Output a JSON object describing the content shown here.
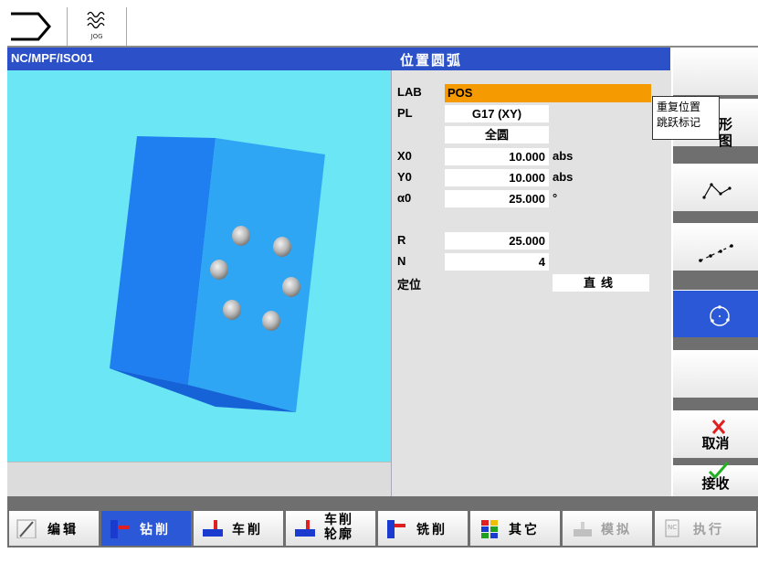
{
  "topbar": {
    "mode_label": "JOG"
  },
  "titlebar": {
    "path": "NC/MPF/ISO01",
    "title": "位置圆弧"
  },
  "params": {
    "lab": {
      "label": "LAB",
      "value": "POS"
    },
    "pl": {
      "label": "PL",
      "value": "G17 (XY)"
    },
    "full": {
      "value": "全圆"
    },
    "x0": {
      "label": "X0",
      "value": "10.000",
      "unit": "abs"
    },
    "y0": {
      "label": "Y0",
      "value": "10.000",
      "unit": "abs"
    },
    "a0": {
      "label": "α0",
      "value": "25.000",
      "unit": "°"
    },
    "r": {
      "label": "R",
      "value": "25.000"
    },
    "n": {
      "label": "N",
      "value": "4"
    },
    "positioning": {
      "label": "定位",
      "value": "直线"
    }
  },
  "tooltip": {
    "line1": "重复位置",
    "line2": "跳跃标记"
  },
  "right_softkeys": {
    "graphic_view_partial": "形\n图",
    "cancel": "取消",
    "accept": "接收"
  },
  "bottom_softkeys": [
    {
      "label": "编辑",
      "icon": "edit-icon"
    },
    {
      "label": "钻削",
      "icon": "drill-icon"
    },
    {
      "label": "车削",
      "icon": "turn-icon"
    },
    {
      "label": "车削轮廓",
      "line1": "车削",
      "line2": "轮廓",
      "icon": "contour-turn-icon"
    },
    {
      "label": "铣削",
      "icon": "mill-icon"
    },
    {
      "label": "其它",
      "icon": "misc-icon"
    },
    {
      "label": "模拟",
      "icon": "simulate-icon"
    },
    {
      "label": "执行",
      "icon": "execute-icon"
    }
  ],
  "colors": {
    "title_blue": "#2b50c8",
    "graphic_bg": "#6ae6f4",
    "lab_highlight": "#f59a00",
    "active_softkey": "#2b58d6"
  }
}
